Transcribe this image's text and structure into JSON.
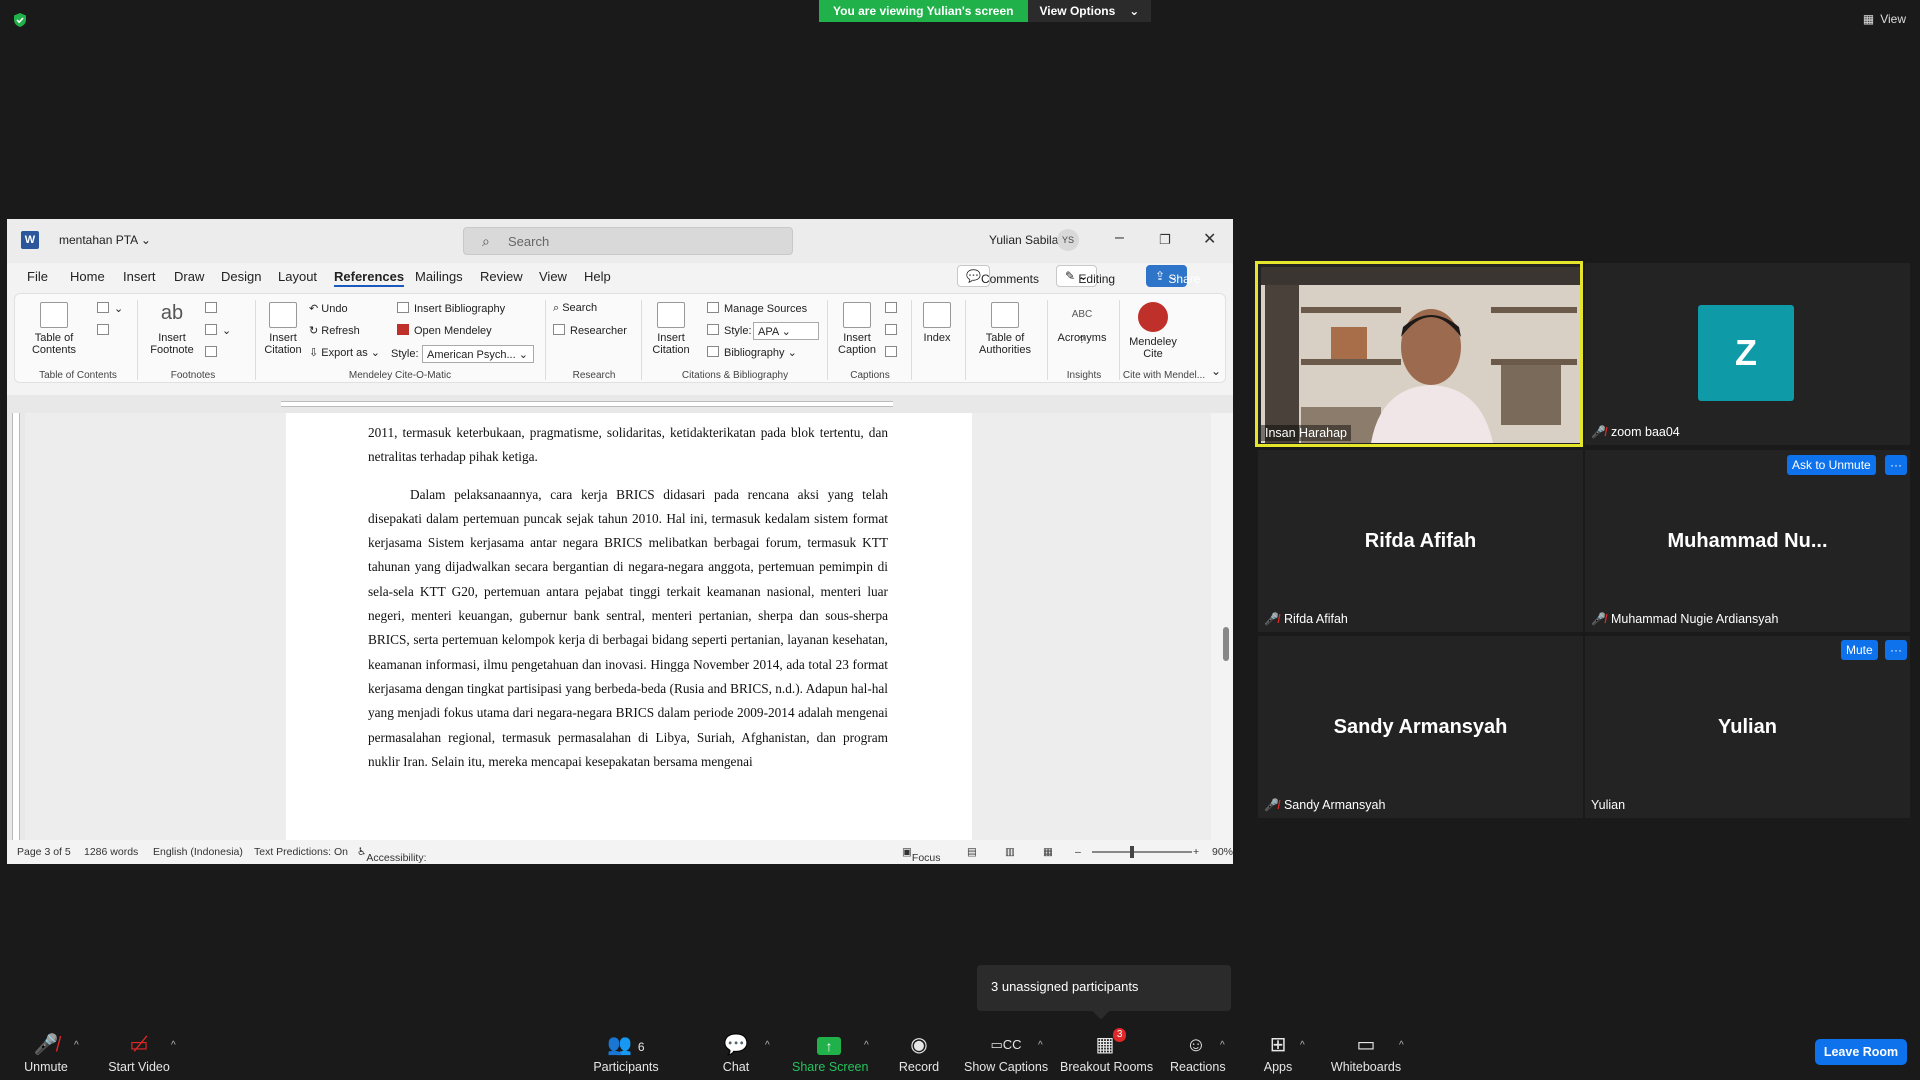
{
  "banner": {
    "viewing": "You are viewing Yulian's screen",
    "view_options": "View Options",
    "view": "View"
  },
  "word": {
    "doc_name": "mentahan PTA",
    "search_placeholder": "Search",
    "user_name": "Yulian Sabila",
    "user_initials": "YS",
    "menu": [
      "File",
      "Home",
      "Insert",
      "Draw",
      "Design",
      "Layout",
      "References",
      "Mailings",
      "Review",
      "View",
      "Help"
    ],
    "active_menu": "References",
    "comments": "Comments",
    "editing": "Editing",
    "share": "Share",
    "ribbon": {
      "toc": "Table of Contents",
      "insert_footnote": "Insert Footnote",
      "insert_citation_1": "Insert Citation",
      "undo": "Undo",
      "refresh": "Refresh",
      "export_as": "Export as",
      "style_label": "Style:",
      "style_value": "American Psych...",
      "insert_bibliography": "Insert Bibliography",
      "open_mendeley": "Open Mendeley",
      "search": "Search",
      "researcher": "Researcher",
      "insert_citation_2": "Insert Citation",
      "manage_sources": "Manage Sources",
      "style2_value": "APA",
      "bibliography": "Bibliography",
      "insert_caption": "Insert Caption",
      "index": "Index",
      "toa": "Table of Authorities",
      "acronyms": "Acronyms",
      "mendeley_cite": "Mendeley Cite",
      "groups": {
        "toc": "Table of Contents",
        "footnotes": "Footnotes",
        "mendeley": "Mendeley Cite-O-Matic",
        "research": "Research",
        "citations": "Citations & Bibliography",
        "captions": "Captions",
        "insights": "Insights",
        "cite_with": "Cite with Mendel..."
      }
    },
    "doc": {
      "p1": "2011, termasuk keterbukaan, pragmatisme, solidaritas, ketidakterikatan pada blok tertentu, dan netralitas terhadap pihak ketiga.",
      "p2": "Dalam pelaksanaannya, cara kerja BRICS didasari pada rencana aksi yang telah disepakati dalam pertemuan puncak sejak tahun 2010. Hal ini, termasuk kedalam sistem format kerjasama Sistem kerjasama antar negara BRICS melibatkan berbagai forum, termasuk KTT tahunan yang dijadwalkan secara bergantian di negara-negara anggota, pertemuan pemimpin di sela-sela KTT G20, pertemuan antara pejabat tinggi terkait keamanan nasional, menteri luar negeri, menteri keuangan, gubernur bank sentral, menteri pertanian, sherpa dan sous-sherpa BRICS, serta pertemuan kelompok kerja di berbagai bidang seperti pertanian, layanan kesehatan, keamanan informasi, ilmu pengetahuan dan inovasi. Hingga November 2014, ada total 23 format kerjasama dengan tingkat partisipasi yang berbeda-beda (Rusia and BRICS, n.d.). Adapun hal-hal yang menjadi fokus utama dari negara-negara BRICS dalam periode 2009-2014 adalah mengenai permasalahan regional, termasuk permasalahan di Libya, Suriah, Afghanistan, dan program nuklir Iran. Selain itu, mereka mencapai kesepakatan bersama mengenai"
    },
    "status": {
      "page": "Page 3 of 5",
      "words": "1286 words",
      "language": "English (Indonesia)",
      "predictions": "Text Predictions: On",
      "accessibility": "Accessibility: Good to go",
      "focus": "Focus",
      "zoom": "90%"
    }
  },
  "participants": {
    "insan": "Insan Harahap",
    "zoom_label": "zoom baa04",
    "zoom_initial": "Z",
    "rifda_big": "Rifda Afifah",
    "rifda": "Rifda Afifah",
    "muhammad_big": "Muhammad  Nu...",
    "muhammad": "Muhammad Nugie Ardiansyah",
    "ask_unmute": "Ask to Unmute",
    "sandy_big": "Sandy Armansyah",
    "sandy": "Sandy Armansyah",
    "yulian_big": "Yulian",
    "yulian": "Yulian",
    "mute": "Mute",
    "more": "···"
  },
  "popup": {
    "unassigned": "3 unassigned participants"
  },
  "toolbar": {
    "unmute": "Unmute",
    "start_video": "Start Video",
    "participants": "Participants",
    "participants_count": "6",
    "chat": "Chat",
    "share_screen": "Share Screen",
    "record": "Record",
    "show_captions": "Show Captions",
    "breakout_rooms": "Breakout Rooms",
    "breakout_badge": "3",
    "reactions": "Reactions",
    "apps": "Apps",
    "whiteboards": "Whiteboards",
    "leave_room": "Leave Room"
  },
  "colors": {
    "zoom_green": "#21b14b",
    "zoom_blue": "#0e72ed",
    "active_speaker": "#e5e52a",
    "word_blue": "#2b579a",
    "muted_red": "#e02828"
  }
}
